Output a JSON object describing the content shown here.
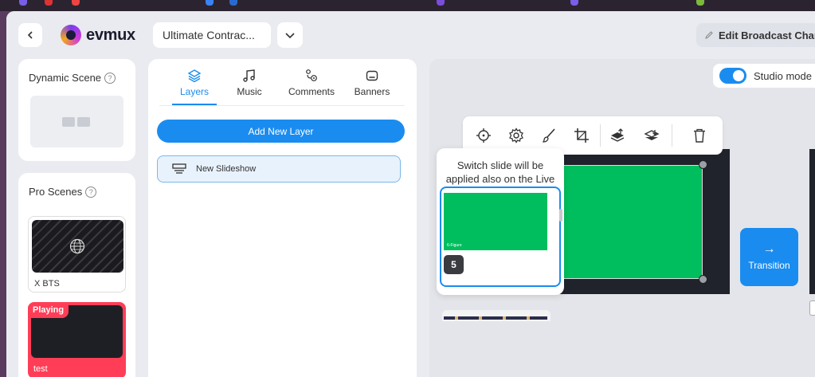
{
  "header": {
    "back_icon": "chevron-left-icon",
    "logo_text": "evmux",
    "broadcast_name": "Ultimate Contrac...",
    "dropdown_icon": "chevron-down-icon",
    "edit_label": "Edit Broadcast Char"
  },
  "dynamic_scene": {
    "title": "Dynamic Scene",
    "help": "?"
  },
  "pro_scenes": {
    "title": "Pro Scenes",
    "help": "?",
    "items": [
      {
        "label": "X BTS",
        "icon": "globe-icon"
      },
      {
        "label": "test",
        "badge": "Playing"
      }
    ]
  },
  "tabs": [
    {
      "label": "Layers",
      "icon": "layers-icon",
      "active": true
    },
    {
      "label": "Music",
      "icon": "music-icon"
    },
    {
      "label": "Comments",
      "icon": "comments-icon"
    },
    {
      "label": "Banners",
      "icon": "banner-icon"
    }
  ],
  "layers": {
    "add_label": "Add New Layer",
    "items": [
      {
        "label": "New Slideshow",
        "icon": "slideshow-icon"
      }
    ]
  },
  "stage": {
    "studio_mode_label": "Studio mode",
    "studio_mode_on": true,
    "toolbar_icons": [
      "crosshair-icon",
      "gear-icon",
      "brush-icon",
      "crop-icon",
      "bring-forward-icon",
      "send-backward-icon",
      "trash-icon"
    ],
    "popover_text": "Switch slide will be applied also on the Live",
    "slide_thumb_label": "6-Figure",
    "slide_number": "5",
    "transition_label": "Transition",
    "transition_arrow": "→"
  },
  "colors": {
    "accent": "#1a8cf0",
    "live_red": "#ff3d57",
    "canvas_green": "#00be5d"
  }
}
